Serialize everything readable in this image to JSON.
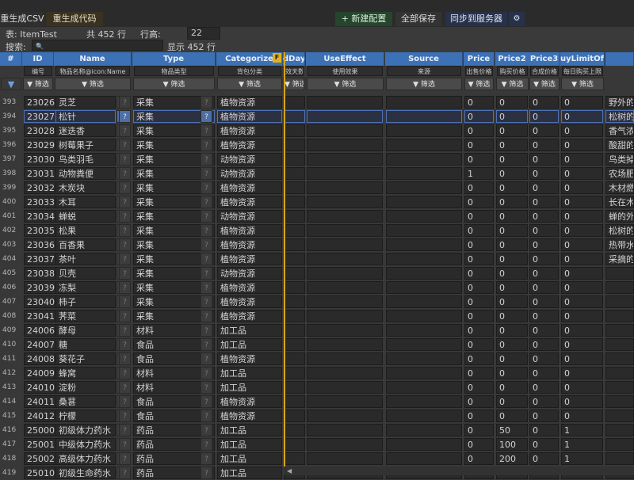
{
  "toolbar": {
    "regen_csv": "重生成CSV",
    "regen_code": "重生成代码",
    "new_config": "+ 新建配置",
    "save_all": "全部保存",
    "sync": "同步到服务器",
    "gear": "⚙"
  },
  "info": {
    "table_label": "表: ItemTest",
    "total": "共 452 行",
    "row_height_label": "行高:",
    "row_height_value": "22",
    "search_label": "搜索:",
    "search_icon": "🔍",
    "showing": "显示 452 行"
  },
  "columns": [
    {
      "key": "rownum",
      "header": "#",
      "desc": "",
      "filter": "▼"
    },
    {
      "key": "id",
      "header": "ID",
      "desc": "编号",
      "filter": "▼ 筛选"
    },
    {
      "key": "name",
      "header": "Name",
      "desc": "物品名称@icon:Name",
      "filter": "▼ 筛选"
    },
    {
      "key": "type",
      "header": "Type",
      "desc": "物品类型",
      "filter": "▼ 筛选"
    },
    {
      "key": "cat",
      "header": "Categorize",
      "desc": "背包分类",
      "filter": "▼ 筛选"
    },
    {
      "key": "days",
      "header": "dDays",
      "desc": "效天数",
      "filter": "▼ 筛选"
    },
    {
      "key": "effect",
      "header": "UseEffect",
      "desc": "使用效果",
      "filter": "▼ 筛选"
    },
    {
      "key": "source",
      "header": "Source",
      "desc": "来源",
      "filter": "▼ 筛选"
    },
    {
      "key": "price",
      "header": "Price",
      "desc": "出售价格",
      "filter": "▼ 筛选"
    },
    {
      "key": "price2",
      "header": "Price2",
      "desc": "购买价格",
      "filter": "▼ 筛选"
    },
    {
      "key": "price3",
      "header": "Price3",
      "desc": "合成价格",
      "filter": "▼ 筛选"
    },
    {
      "key": "limit",
      "header": "uyLimitOfDay",
      "desc": "每日购买上限",
      "filter": "▼ 筛选"
    },
    {
      "key": "desc",
      "header": "",
      "desc": "",
      "filter": ""
    }
  ],
  "rows": [
    {
      "n": "393",
      "id": "23026",
      "name": "灵芝",
      "type": "采集",
      "cat": "植物资源",
      "price": "0",
      "price2": "0",
      "price3": "0",
      "limit": "0",
      "desc": "野外的腐"
    },
    {
      "n": "394",
      "id": "23027",
      "name": "松针",
      "type": "采集",
      "cat": "植物资源",
      "price": "0",
      "price2": "0",
      "price3": "0",
      "limit": "0",
      "desc": "松树的叶"
    },
    {
      "n": "395",
      "id": "23028",
      "name": "迷迭香",
      "type": "采集",
      "cat": "植物资源",
      "price": "0",
      "price2": "0",
      "price3": "0",
      "limit": "0",
      "desc": "香气浓郁"
    },
    {
      "n": "396",
      "id": "23029",
      "name": "树莓果子",
      "type": "采集",
      "cat": "植物资源",
      "price": "0",
      "price2": "0",
      "price3": "0",
      "limit": "0",
      "desc": "酸甜的浆"
    },
    {
      "n": "397",
      "id": "23030",
      "name": "鸟类羽毛",
      "type": "采集",
      "cat": "动物资源",
      "price": "0",
      "price2": "0",
      "price3": "0",
      "limit": "0",
      "desc": "鸟类掉落"
    },
    {
      "n": "398",
      "id": "23031",
      "name": "动物粪便",
      "type": "采集",
      "cat": "动物资源",
      "price": "1",
      "price2": "0",
      "price3": "0",
      "limit": "0",
      "desc": "农场肥料"
    },
    {
      "n": "399",
      "id": "23032",
      "name": "木炭块",
      "type": "采集",
      "cat": "植物资源",
      "price": "0",
      "price2": "0",
      "price3": "0",
      "limit": "0",
      "desc": "木材燃烧"
    },
    {
      "n": "400",
      "id": "23033",
      "name": "木耳",
      "type": "采集",
      "cat": "植物资源",
      "price": "0",
      "price2": "0",
      "price3": "0",
      "limit": "0",
      "desc": "长在木头"
    },
    {
      "n": "401",
      "id": "23034",
      "name": "蝉蜕",
      "type": "采集",
      "cat": "动物资源",
      "price": "0",
      "price2": "0",
      "price3": "0",
      "limit": "0",
      "desc": "蝉的外壳"
    },
    {
      "n": "402",
      "id": "23035",
      "name": "松果",
      "type": "采集",
      "cat": "植物资源",
      "price": "0",
      "price2": "0",
      "price3": "0",
      "limit": "0",
      "desc": "松树的果"
    },
    {
      "n": "403",
      "id": "23036",
      "name": "百香果",
      "type": "采集",
      "cat": "植物资源",
      "price": "0",
      "price2": "0",
      "price3": "0",
      "limit": "0",
      "desc": "热带水果"
    },
    {
      "n": "404",
      "id": "23037",
      "name": "茶叶",
      "type": "采集",
      "cat": "植物资源",
      "price": "0",
      "price2": "0",
      "price3": "0",
      "limit": "0",
      "desc": "采摘的嫩"
    },
    {
      "n": "405",
      "id": "23038",
      "name": "贝壳",
      "type": "采集",
      "cat": "动物资源",
      "price": "0",
      "price2": "0",
      "price3": "0",
      "limit": "0",
      "desc": ""
    },
    {
      "n": "406",
      "id": "23039",
      "name": "冻梨",
      "type": "采集",
      "cat": "植物资源",
      "price": "0",
      "price2": "0",
      "price3": "0",
      "limit": "0",
      "desc": ""
    },
    {
      "n": "407",
      "id": "23040",
      "name": "柿子",
      "type": "采集",
      "cat": "植物资源",
      "price": "0",
      "price2": "0",
      "price3": "0",
      "limit": "0",
      "desc": ""
    },
    {
      "n": "408",
      "id": "23041",
      "name": "荠菜",
      "type": "采集",
      "cat": "植物资源",
      "price": "0",
      "price2": "0",
      "price3": "0",
      "limit": "0",
      "desc": ""
    },
    {
      "n": "409",
      "id": "24006",
      "name": "酵母",
      "type": "材料",
      "cat": "加工品",
      "price": "0",
      "price2": "0",
      "price3": "0",
      "limit": "0",
      "desc": ""
    },
    {
      "n": "410",
      "id": "24007",
      "name": "糖",
      "type": "食品",
      "cat": "加工品",
      "price": "0",
      "price2": "0",
      "price3": "0",
      "limit": "0",
      "desc": ""
    },
    {
      "n": "411",
      "id": "24008",
      "name": "葵花子",
      "type": "食品",
      "cat": "植物资源",
      "price": "0",
      "price2": "0",
      "price3": "0",
      "limit": "0",
      "desc": ""
    },
    {
      "n": "412",
      "id": "24009",
      "name": "蜂窝",
      "type": "材料",
      "cat": "加工品",
      "price": "0",
      "price2": "0",
      "price3": "0",
      "limit": "0",
      "desc": ""
    },
    {
      "n": "413",
      "id": "24010",
      "name": "淀粉",
      "type": "材料",
      "cat": "加工品",
      "price": "0",
      "price2": "0",
      "price3": "0",
      "limit": "0",
      "desc": ""
    },
    {
      "n": "414",
      "id": "24011",
      "name": "桑葚",
      "type": "食品",
      "cat": "植物资源",
      "price": "0",
      "price2": "0",
      "price3": "0",
      "limit": "0",
      "desc": ""
    },
    {
      "n": "415",
      "id": "24012",
      "name": "柠檬",
      "type": "食品",
      "cat": "植物资源",
      "price": "0",
      "price2": "0",
      "price3": "0",
      "limit": "0",
      "desc": ""
    },
    {
      "n": "416",
      "id": "25000",
      "name": "初级体力药水",
      "type": "药品",
      "cat": "加工品",
      "price": "0",
      "price2": "50",
      "price3": "0",
      "limit": "1",
      "desc": ""
    },
    {
      "n": "417",
      "id": "25001",
      "name": "中级体力药水",
      "type": "药品",
      "cat": "加工品",
      "price": "0",
      "price2": "100",
      "price3": "0",
      "limit": "1",
      "desc": ""
    },
    {
      "n": "418",
      "id": "25002",
      "name": "高级体力药水",
      "type": "药品",
      "cat": "加工品",
      "price": "0",
      "price2": "200",
      "price3": "0",
      "limit": "1",
      "desc": ""
    },
    {
      "n": "419",
      "id": "25010",
      "name": "初级生命药水",
      "type": "药品",
      "cat": "加工品",
      "price": "",
      "price2": "",
      "price3": "",
      "limit": "",
      "desc": ""
    }
  ],
  "selected_row": "394",
  "colors": {
    "header": "#3c71b6",
    "accent_line": "#d6a416",
    "selected_border": "#4d72b8"
  }
}
